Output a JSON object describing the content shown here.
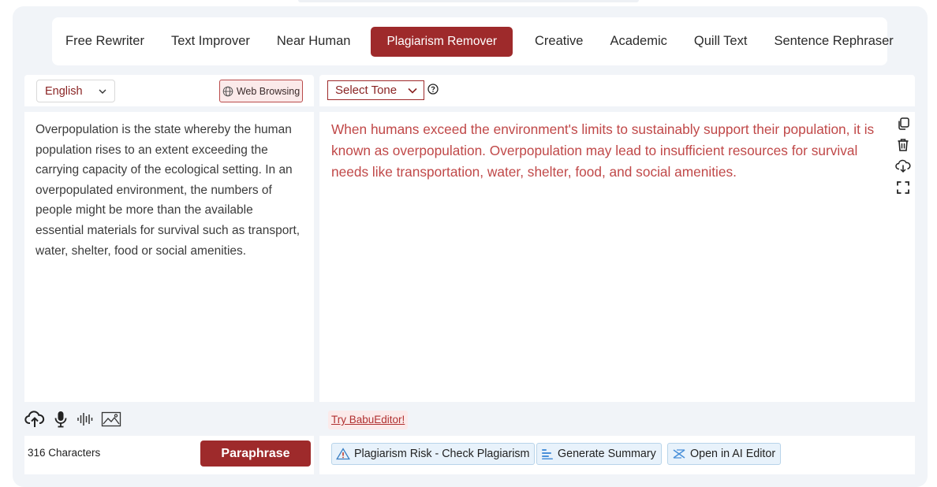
{
  "tabs": [
    {
      "label": "Free Rewriter",
      "active": false
    },
    {
      "label": "Text Improver",
      "active": false
    },
    {
      "label": "Near Human",
      "active": false
    },
    {
      "label": "Plagiarism Remover",
      "active": true
    },
    {
      "label": "Creative",
      "active": false
    },
    {
      "label": "Academic",
      "active": false
    },
    {
      "label": "Quill Text",
      "active": false
    },
    {
      "label": "Sentence Rephraser",
      "active": false
    }
  ],
  "left_toolbar": {
    "language": "English",
    "web_browsing_label": "Web Browsing"
  },
  "right_toolbar": {
    "tone_label": "Select Tone"
  },
  "input": {
    "text": "Overpopulation is the state whereby the human population rises to an extent exceeding the carrying capacity of the ecological setting. In an overpopulated environment, the numbers of people might be more than the available essential materials for survival such as transport, water, shelter, food or social amenities."
  },
  "output": {
    "text": "When humans exceed the environment's limits to sustainably support their population, it is known as overpopulation. Overpopulation may lead to insufficient resources for survival needs like transportation, water, shelter, food, and social amenities."
  },
  "footer_left": {
    "char_count": "316 Characters",
    "paraphrase_label": "Paraphrase"
  },
  "footer_right": {
    "try_link": "Try BabuEditor!",
    "plagiarism_label": "Plagiarism Risk - Check Plagiarism",
    "summary_label": "Generate Summary",
    "ai_editor_label": "Open in AI Editor"
  },
  "icons": {
    "input_tools": [
      "upload-cloud-icon",
      "microphone-icon",
      "audio-wave-icon",
      "image-icon"
    ],
    "output_tools": [
      "copy-icon",
      "trash-icon",
      "download-cloud-icon",
      "fullscreen-icon"
    ]
  },
  "colors": {
    "brand": "#9e2a2b",
    "output_text": "#c04848",
    "panel_bg": "#f1f4f8",
    "action_button_bg": "#e8f2fb"
  }
}
